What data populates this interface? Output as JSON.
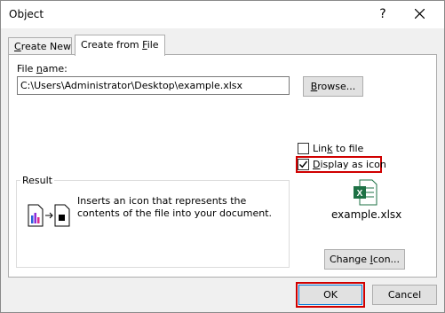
{
  "window": {
    "title": "Object",
    "help_label": "?"
  },
  "tabs": [
    {
      "label_pre": "",
      "label_u": "C",
      "label_post": "reate New"
    },
    {
      "label_pre": "Create from ",
      "label_u": "F",
      "label_post": "ile"
    }
  ],
  "file": {
    "label_pre": "File ",
    "label_u": "n",
    "label_post": "ame:",
    "value": "C:\\Users\\Administrator\\Desktop\\example.xlsx",
    "browse_pre": "",
    "browse_u": "B",
    "browse_post": "rowse..."
  },
  "options": {
    "link": {
      "label_pre": "Lin",
      "label_u": "k",
      "label_post": " to file",
      "checked": false
    },
    "display": {
      "label_pre": "",
      "label_u": "D",
      "label_post": "isplay as icon",
      "checked": true
    }
  },
  "result": {
    "legend": "Result",
    "text": "Inserts an icon that represents the contents of the file into your document."
  },
  "icon_preview": {
    "icon": "excel-file-icon",
    "caption": "example.xlsx",
    "change_pre": "Change ",
    "change_u": "I",
    "change_post": "con..."
  },
  "buttons": {
    "ok": "OK",
    "cancel": "Cancel"
  },
  "colors": {
    "highlight": "#d00000",
    "excel_green": "#1e7145"
  }
}
